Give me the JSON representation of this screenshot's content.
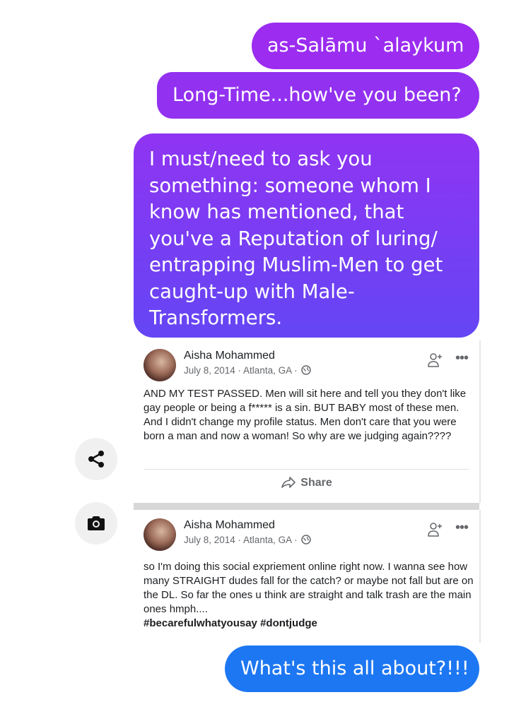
{
  "messages": [
    {
      "text": "as-Salāmu `alaykum"
    },
    {
      "text": "Long-Time...how've you been?"
    },
    {
      "text": "I must/need to ask you something: someone whom I know has mentioned, that you've a Reputation of luring/ entrapping Muslim-Men to get caught-up with Male-Transformers."
    },
    {
      "text": "What's this all about?!!!"
    }
  ],
  "icons": {
    "share": "share-icon",
    "camera": "camera-icon",
    "add_friend": "add-friend-icon",
    "more": "more-icon",
    "globe": "globe-icon",
    "share_arrow": "share-arrow-icon"
  },
  "posts": [
    {
      "author": "Aisha Mohammed",
      "meta": "July 8, 2014 · Atlanta, GA ·",
      "text": "AND MY TEST PASSED. Men will sit here and tell you they don't like gay people or being a f***** is a sin. BUT BABY most of these men. And I didn't change my profile status. Men don't care that you were born a man and now a woman! So why are we judging again????",
      "share_label": "Share"
    },
    {
      "author": "Aisha Mohammed",
      "meta": "July 8, 2014 · Atlanta, GA ·",
      "text": "so I'm doing this social expriement online right now. I wanna see how many STRAIGHT dudes fall for the catch? or maybe not fall but are on the DL. So far the ones u think are straight and talk trash are the main ones hmph....",
      "hashtags": "#becarefulwhatyousay #dontjudge"
    }
  ],
  "colors": {
    "sent_purple": "#9b2cf0",
    "sent_blue": "#1d77f2",
    "gradient_end": "#6446f4"
  }
}
